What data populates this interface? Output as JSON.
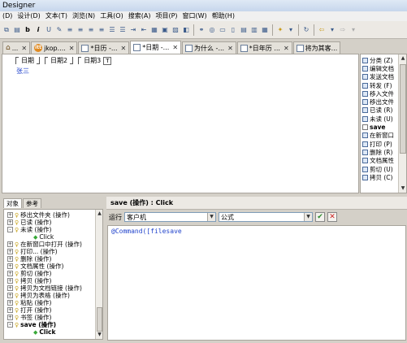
{
  "window": {
    "title": "Designer"
  },
  "menu": [
    "(D)",
    "设计(D)",
    "文本(T)",
    "浏览(N)",
    "工具(O)",
    "搜索(A)",
    "项目(P)",
    "窗口(W)",
    "帮助(H)"
  ],
  "tabs": [
    {
      "label": "...",
      "icon": "home-icon"
    },
    {
      "label": "jkop....",
      "icon": "notes-app-icon"
    },
    {
      "label": "*日历 -...",
      "icon": "form-icon"
    },
    {
      "label": "*日期 -...",
      "icon": "form-icon",
      "active": true
    },
    {
      "label": "为什么 -...",
      "icon": "form-icon"
    },
    {
      "label": "*日年历 ...",
      "icon": "form-icon"
    },
    {
      "label": "将为其客...",
      "icon": "form-icon"
    }
  ],
  "form": {
    "fields": [
      "日期",
      "日期2",
      "日期3"
    ],
    "text": "张三"
  },
  "actions": [
    "分类 (Z)",
    "编辑文档",
    "发送文档",
    "转发 (F)",
    "移入文件",
    "移出文件",
    "已读 (R)",
    "未读 (U)",
    "save",
    "在新窗口",
    "打印 (P)",
    "删除 (R)",
    "文档属性",
    "剪切 (U)",
    "拷贝 (C)"
  ],
  "nav_panel": {
    "tabs": [
      "对象",
      "参考"
    ],
    "tree": [
      {
        "label": "移出文件夹 (操作)",
        "level": 0,
        "expander": "+"
      },
      {
        "label": "已读 (操作)",
        "level": 0,
        "expander": "+"
      },
      {
        "label": "未读 (操作)",
        "level": 0,
        "expander": "-"
      },
      {
        "label": "Click",
        "level": 1,
        "expander": ""
      },
      {
        "label": "在新窗口中打开 (操作)",
        "level": 0,
        "expander": "+"
      },
      {
        "label": "打印... (操作)",
        "level": 0,
        "expander": "+"
      },
      {
        "label": "删除 (操作)",
        "level": 0,
        "expander": "+"
      },
      {
        "label": "文档属性 (操作)",
        "level": 0,
        "expander": "+"
      },
      {
        "label": "剪切 (操作)",
        "level": 0,
        "expander": "+"
      },
      {
        "label": "拷贝 (操作)",
        "level": 0,
        "expander": "+"
      },
      {
        "label": "拷贝为文档链接 (操作)",
        "level": 0,
        "expander": "+"
      },
      {
        "label": "拷贝为表格 (操作)",
        "level": 0,
        "expander": "+"
      },
      {
        "label": "粘贴 (操作)",
        "level": 0,
        "expander": "+"
      },
      {
        "label": "打开 (操作)",
        "level": 0,
        "expander": "+"
      },
      {
        "label": "书签 (操作)",
        "level": 0,
        "expander": "+"
      },
      {
        "label": "save (操作)",
        "level": 0,
        "expander": "-",
        "bold": true
      },
      {
        "label": "Click",
        "level": 1,
        "expander": "",
        "bold": true
      }
    ]
  },
  "editor_panel": {
    "header": "save (操作) : Click",
    "run_label": "运行",
    "run_value": "客户机",
    "lang_value": "公式",
    "ok_glyph": "✔",
    "cancel_glyph": "✕",
    "code": "@Command([filesave"
  }
}
